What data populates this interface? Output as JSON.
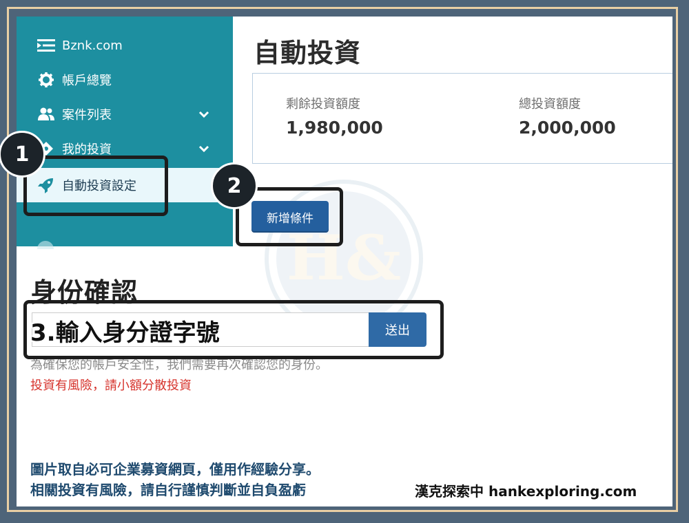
{
  "sidebar": {
    "items": [
      {
        "label": "Bznk.com",
        "icon": "list-icon"
      },
      {
        "label": "帳戶總覽",
        "icon": "gear-icon"
      },
      {
        "label": "案件列表",
        "icon": "users-icon",
        "has_chevron": true
      },
      {
        "label": "我的投資",
        "icon": "tag-icon",
        "has_chevron": true
      },
      {
        "label": "自動投資設定",
        "icon": "rocket-icon",
        "active": true
      }
    ]
  },
  "main": {
    "title": "自動投資",
    "stats": [
      {
        "label": "剩餘投資額度",
        "value": "1,980,000"
      },
      {
        "label": "總投資額度",
        "value": "2,000,000"
      }
    ],
    "add_button": "新增條件"
  },
  "identity": {
    "title": "身份確認",
    "input_overlay": "3.輸入身分證字號",
    "submit_label": "送出",
    "help_text": "為確保您的帳戶安全性，我們需要再次確認您的身份。",
    "risk_text": "投資有風險，請小額分散投資"
  },
  "annotations": {
    "step1": "1",
    "step2": "2"
  },
  "footer": {
    "line1": "圖片取自必可企業募資網頁，僅用作經驗分享。",
    "line2": "相關投資有風險，請自行謹慎判斷並自負盈虧",
    "brand": "漢克探索中 hankexploring.com"
  },
  "colors": {
    "sidebar": "#1d8fa0",
    "button": "#245f9e",
    "risk": "#d6332c",
    "frame": "#4e6479",
    "frame_accent": "#e9cfa4"
  }
}
